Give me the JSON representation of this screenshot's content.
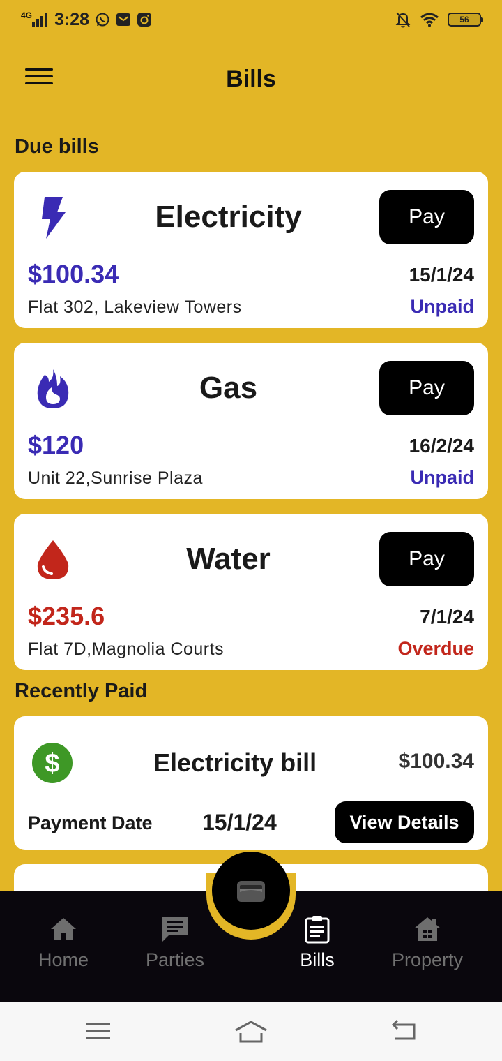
{
  "status_bar": {
    "network": "4G",
    "time": "3:28",
    "battery": "56"
  },
  "app_bar": {
    "title": "Bills"
  },
  "sections": {
    "due_title": "Due bills",
    "paid_title": "Recently Paid"
  },
  "due_bills": [
    {
      "title": "Electricity",
      "icon": "lightning-bolt-icon",
      "pay_label": "Pay",
      "amount": "$100.34",
      "amount_color": "#3a2bb4",
      "date": "15/1/24",
      "address": "Flat 302, Lakeview Towers",
      "status": "Unpaid",
      "status_color": "#3a2bb4"
    },
    {
      "title": "Gas",
      "icon": "flame-icon",
      "pay_label": "Pay",
      "amount": "$120",
      "amount_color": "#3a2bb4",
      "date": "16/2/24",
      "address": "Unit 22,Sunrise Plaza",
      "status": "Unpaid",
      "status_color": "#3a2bb4"
    },
    {
      "title": "Water",
      "icon": "water-drop-icon",
      "pay_label": "Pay",
      "amount": "$235.6",
      "amount_color": "#c2261b",
      "date": "7/1/24",
      "address": "Flat 7D,Magnolia Courts",
      "status": "Overdue",
      "status_color": "#c2261b"
    }
  ],
  "recently_paid": [
    {
      "title": "Electricity bill",
      "icon": "dollar-icon",
      "amount": "$100.34",
      "date_label": "Payment Date",
      "date": "15/1/24",
      "details_label": "View Details"
    }
  ],
  "bottom_nav": {
    "items": [
      {
        "label": "Home",
        "icon": "home-icon"
      },
      {
        "label": "Parties",
        "icon": "chat-icon"
      },
      {
        "label": "Bills",
        "icon": "clipboard-icon",
        "active": true
      },
      {
        "label": "Property",
        "icon": "property-icon"
      }
    ],
    "fab_icon": "wallet-icon"
  },
  "colors": {
    "background": "#e3b626",
    "nav_background": "#0a070d",
    "primary_blue": "#3a2bb4",
    "overdue_red": "#c2261b",
    "paid_green": "#3e9826"
  }
}
